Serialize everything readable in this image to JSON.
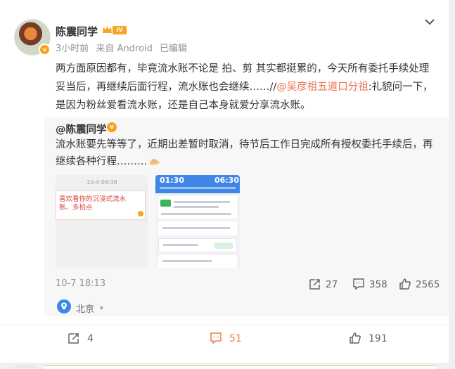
{
  "post": {
    "author": "陈震同学",
    "level": "IV",
    "time": "3小时前",
    "source": "来自 Android",
    "edited": "已编辑",
    "text_part1": "两方面原因都有，毕竟流水账不论是 拍、剪 其实都挺累的，今天所有委托手续处理妥当后，再继续后面行程，流水账也会继续……//",
    "mention": "@吴彦祖五道口分祖",
    "text_part2": ":礼貌问一下，是因为粉丝爱看流水账，还是自己本身就爱分享流水账。"
  },
  "retweet": {
    "author": "@陈震同学",
    "text": "流水账要先等等了，近期出差暂时取消，待节后工作日完成所有授权委托手续后，再继续各种行程………",
    "date": "10-7 18:13",
    "reposts": "27",
    "comments": "358",
    "likes": "2565",
    "location": "北京",
    "image1": {
      "date": "10-4 09:38",
      "note": "喜欢看你的沉浸式流水账、多拍点"
    },
    "image2": {
      "time_depart": "01:30",
      "time_arrive": "06:30"
    }
  },
  "actions": {
    "reposts": "4",
    "comments": "51",
    "likes": "191"
  },
  "colors": {
    "accent": "#eb7350",
    "active": "#f47b45",
    "badge": "#f9a11b",
    "location": "#3f86e6"
  },
  "icons": [
    "more-icon",
    "crown-icon",
    "repost-icon",
    "comment-icon",
    "like-icon",
    "location-icon",
    "clap-emoji"
  ]
}
